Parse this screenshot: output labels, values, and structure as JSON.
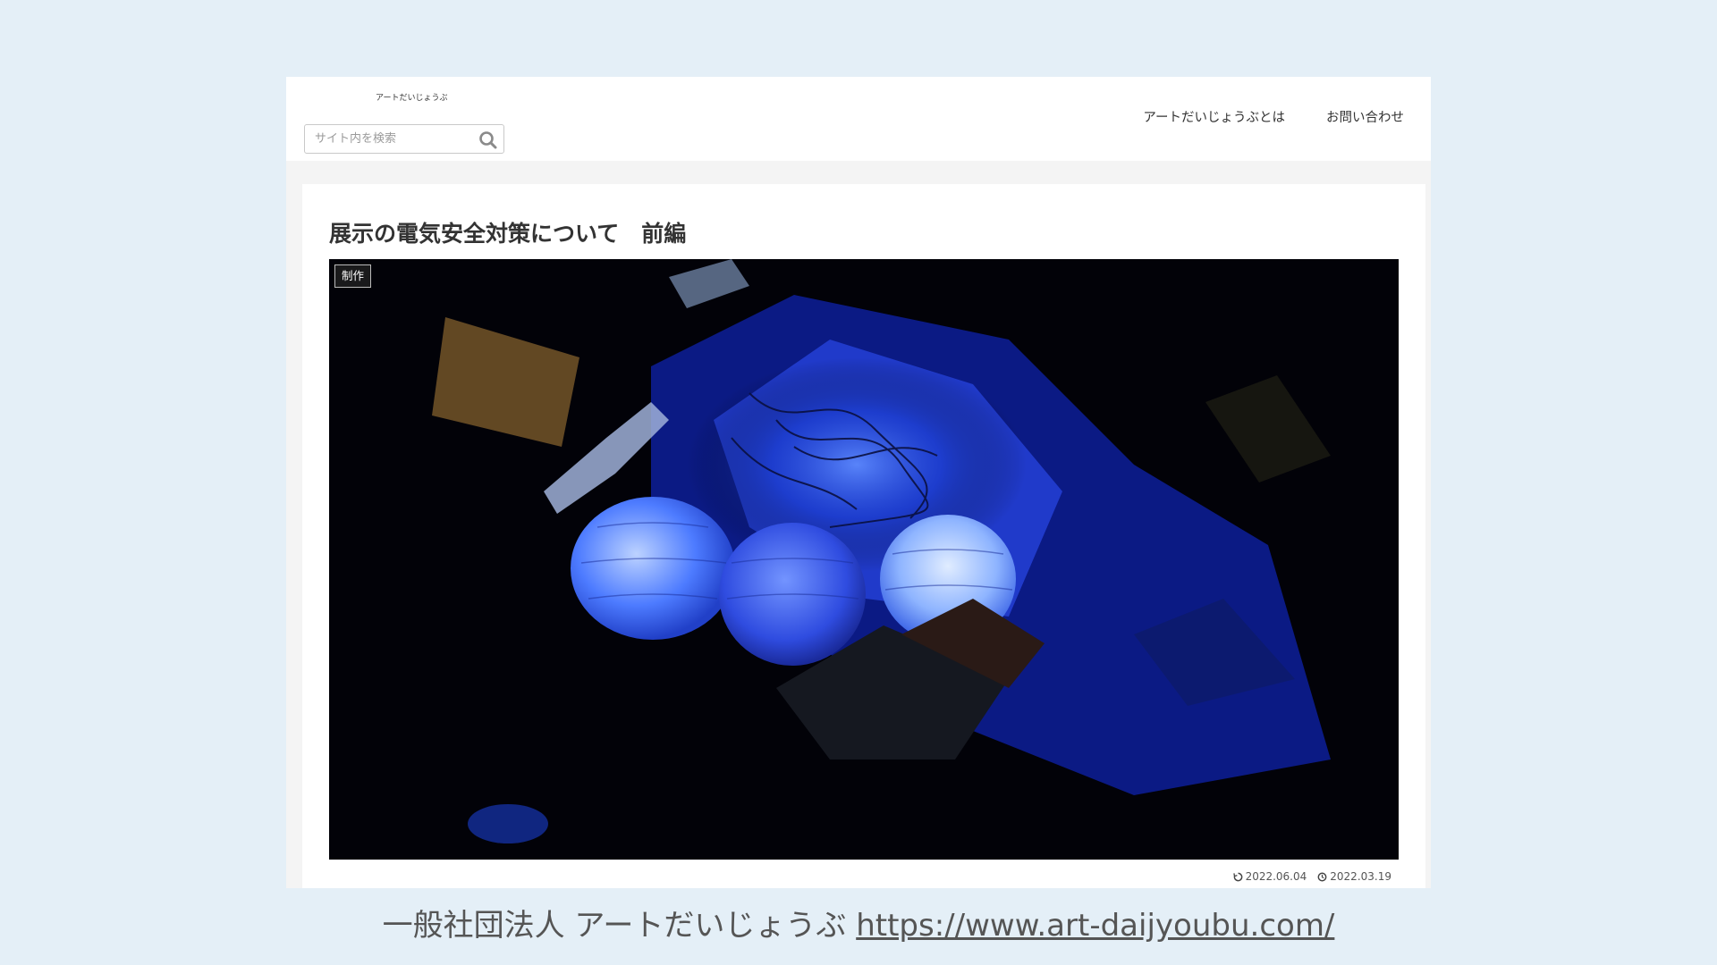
{
  "header": {
    "site_name": "アートだいじょうぶ",
    "search": {
      "placeholder": "サイト内を検索"
    },
    "nav": [
      {
        "label": "アートだいじょうぶとは"
      },
      {
        "label": "お問い合わせ"
      }
    ]
  },
  "article": {
    "title": "展示の電気安全対策について　前編",
    "category": "制作",
    "eyecatch_icon": "lanterns-photo",
    "updated_date": "2022.06.04",
    "published_date": "2022.03.19"
  },
  "footer_caption": {
    "org": "一般社団法人 アートだいじょうぶ",
    "url": "https://www.art-daijyoubu.com/"
  },
  "colors": {
    "background": "#e4eff7",
    "text": "#333333",
    "accent_blue": "#3a6bff"
  }
}
